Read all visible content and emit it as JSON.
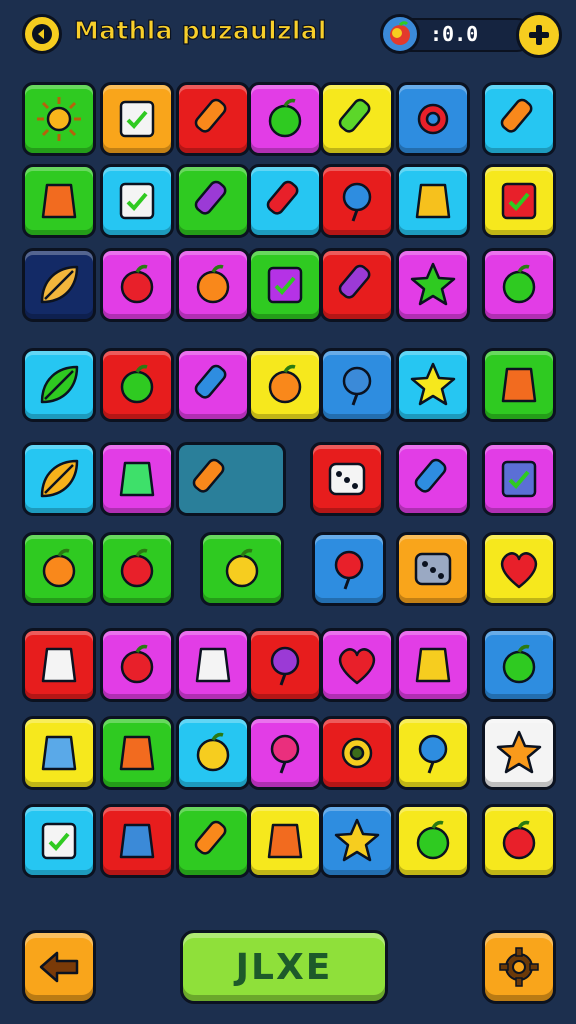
{
  "header": {
    "title": "Mathla puzaulzlal",
    "score": ":0.0"
  },
  "footer": {
    "main_button_label": "JLXE"
  },
  "colors": {
    "background": "#1c2f4e",
    "accent": "#f6cd1f",
    "green": "#2fca21",
    "orange": "#f9a51b",
    "red": "#e71d1d",
    "magenta": "#e23de6",
    "yellow": "#f6e81d",
    "blue": "#2e8de0",
    "cyan": "#26c6f2",
    "navy": "#132a66",
    "teal": "#2a7f9a",
    "white": "#f4f4f4"
  },
  "grid": {
    "rows": [
      [
        {
          "color": "green",
          "icon": "sun-icon"
        },
        {
          "color": "orange",
          "icon": "checklist-card-icon"
        },
        {
          "color": "red",
          "icon": "ice-cream-cone-icon"
        },
        {
          "color": "magenta",
          "icon": "apple-icon"
        },
        {
          "color": "yellow",
          "icon": "cucumber-icon"
        },
        {
          "color": "blue",
          "icon": "gear-icon"
        },
        {
          "color": "cyan",
          "icon": "carrot-icon"
        }
      ],
      [
        {
          "color": "green",
          "icon": "spinning-top-icon"
        },
        {
          "color": "cyan",
          "icon": "chart-board-icon"
        },
        {
          "color": "green",
          "icon": "eggplant-icon"
        },
        {
          "color": "cyan",
          "icon": "pencil-icon"
        },
        {
          "color": "red",
          "icon": "refresh-ring-icon"
        },
        {
          "color": "cyan",
          "icon": "flower-icon"
        },
        {
          "color": "yellow",
          "icon": "flag-icon"
        }
      ],
      [
        {
          "color": "navy",
          "icon": "leaf-icon"
        },
        {
          "color": "magenta",
          "icon": "blueberry-icon"
        },
        {
          "color": "magenta",
          "icon": "smiley-fruit-icon"
        },
        {
          "color": "green",
          "icon": "book-icon"
        },
        {
          "color": "red",
          "icon": "grape-icon"
        },
        {
          "color": "magenta",
          "icon": "star-blob-icon"
        },
        {
          "color": "magenta",
          "icon": "lime-icon"
        }
      ],
      [
        {
          "color": "cyan",
          "icon": "leaves-icon"
        },
        {
          "color": "red",
          "icon": "broccoli-icon"
        },
        {
          "color": "magenta",
          "icon": "crayon-icon"
        },
        {
          "color": "yellow",
          "icon": "pumpkin-icon"
        },
        {
          "color": "blue",
          "icon": "balloon-icon"
        },
        {
          "color": "cyan",
          "icon": "yellow-star-blob-icon"
        },
        {
          "color": "green",
          "icon": "bucket-icon"
        }
      ],
      [
        {
          "color": "cyan",
          "icon": "autumn-leaf-icon"
        },
        {
          "color": "magenta",
          "icon": "potion-flask-icon"
        },
        {
          "color": "teal",
          "icon": "wide-crayon-icon",
          "wide": true
        },
        {
          "color": "red",
          "icon": "dice-icon"
        },
        {
          "color": "magenta",
          "icon": "crayon-icon"
        },
        {
          "color": "magenta",
          "icon": "picture-frame-icon"
        }
      ],
      [
        {
          "color": "green",
          "icon": "orange-fruit-icon"
        },
        {
          "color": "green",
          "icon": "cherries-icon"
        },
        {
          "color": "green",
          "icon": "lemon-icon",
          "offset": true
        },
        {
          "color": "blue",
          "icon": "lollipop-icon"
        },
        {
          "color": "orange",
          "icon": "domino-icon"
        },
        {
          "color": "yellow",
          "icon": "heart-apple-icon"
        }
      ],
      [
        {
          "color": "red",
          "icon": "skull-icon"
        },
        {
          "color": "magenta",
          "icon": "berries-icon"
        },
        {
          "color": "magenta",
          "icon": "cup-icon"
        },
        {
          "color": "red",
          "icon": "purple-balloon-icon"
        },
        {
          "color": "magenta",
          "icon": "heart-icon"
        },
        {
          "color": "magenta",
          "icon": "firework-icon"
        },
        {
          "color": "blue",
          "icon": "green-apple-icon"
        }
      ],
      [
        {
          "color": "yellow",
          "icon": "boot-icon"
        },
        {
          "color": "green",
          "icon": "teddy-bear-icon"
        },
        {
          "color": "cyan",
          "icon": "pear-icon"
        },
        {
          "color": "magenta",
          "icon": "pink-balloon-icon"
        },
        {
          "color": "red",
          "icon": "sunflower-icon"
        },
        {
          "color": "yellow",
          "icon": "ring-icon"
        },
        {
          "color": "white",
          "icon": "star-icon"
        }
      ],
      [
        {
          "color": "cyan",
          "icon": "check-card-icon"
        },
        {
          "color": "red",
          "icon": "gift-box-icon"
        },
        {
          "color": "green",
          "icon": "bone-icon"
        },
        {
          "color": "yellow",
          "icon": "tower-icon"
        },
        {
          "color": "blue",
          "icon": "gold-star-icon"
        },
        {
          "color": "yellow",
          "icon": "green-pepper-icon"
        },
        {
          "color": "yellow",
          "icon": "red-apple-icon"
        }
      ]
    ]
  }
}
